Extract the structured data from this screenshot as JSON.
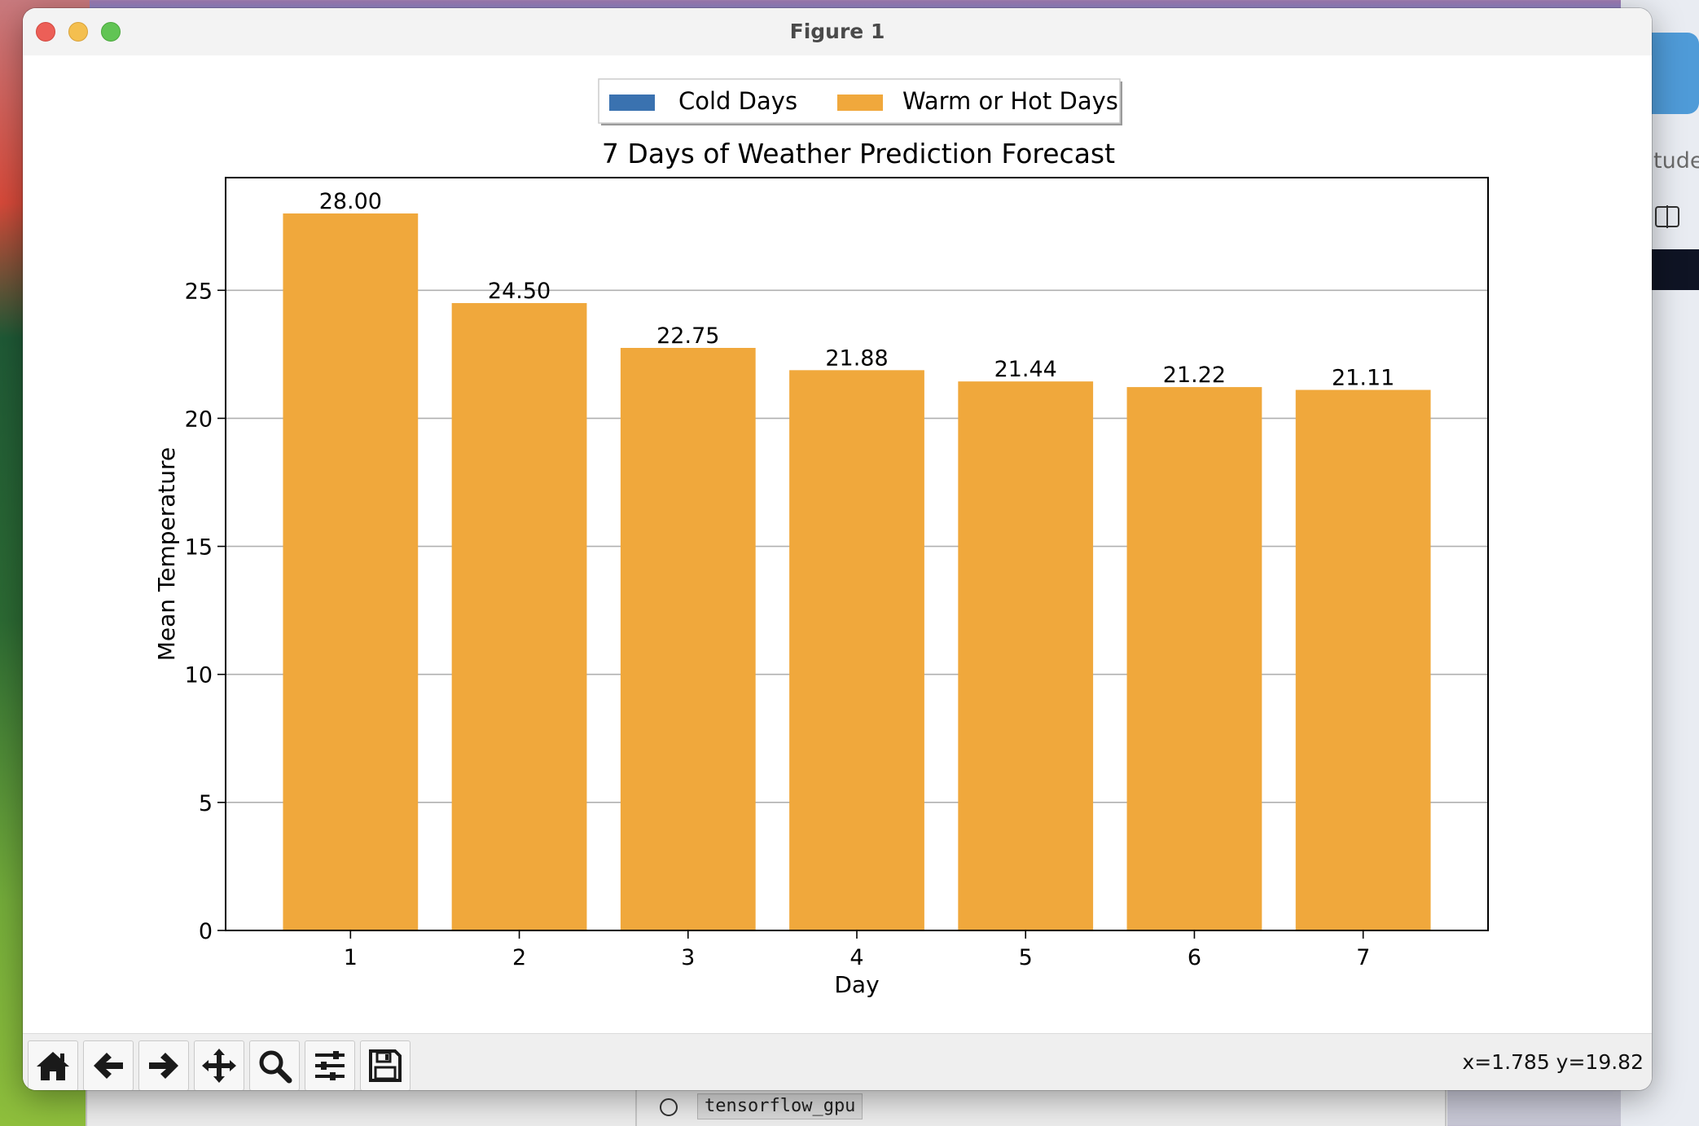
{
  "window": {
    "title": "Figure 1"
  },
  "background": {
    "snippet_text": "tuden",
    "env_tag": "tensorflow_gpu"
  },
  "toolbar": {
    "buttons": [
      {
        "name": "home",
        "icon": "home-icon"
      },
      {
        "name": "back",
        "icon": "arrow-left-icon"
      },
      {
        "name": "forward",
        "icon": "arrow-right-icon"
      },
      {
        "name": "pan",
        "icon": "move-icon"
      },
      {
        "name": "zoom",
        "icon": "magnifier-icon"
      },
      {
        "name": "configure-subplots",
        "icon": "sliders-icon"
      },
      {
        "name": "save",
        "icon": "floppy-disk-icon"
      }
    ],
    "coords": "x=1.785 y=19.82"
  },
  "chart_data": {
    "type": "bar",
    "title": "7 Days of Weather Prediction Forecast",
    "xlabel": "Day",
    "ylabel": "Mean Temperature",
    "categories": [
      "1",
      "2",
      "3",
      "4",
      "5",
      "6",
      "7"
    ],
    "series": [
      {
        "name": "Cold Days",
        "color": "#3a72b0",
        "values": [
          null,
          null,
          null,
          null,
          null,
          null,
          null
        ]
      },
      {
        "name": "Warm or Hot Days",
        "color": "#f0a83c",
        "values": [
          28.0,
          24.5,
          22.75,
          21.88,
          21.44,
          21.22,
          21.11
        ]
      }
    ],
    "data_labels": [
      "28.00",
      "24.50",
      "22.75",
      "21.88",
      "21.44",
      "21.22",
      "21.11"
    ],
    "yticks": [
      0,
      5,
      10,
      15,
      20,
      25
    ],
    "ylim": [
      0,
      29.4
    ],
    "grid": "y",
    "legend_position": "top-center"
  }
}
